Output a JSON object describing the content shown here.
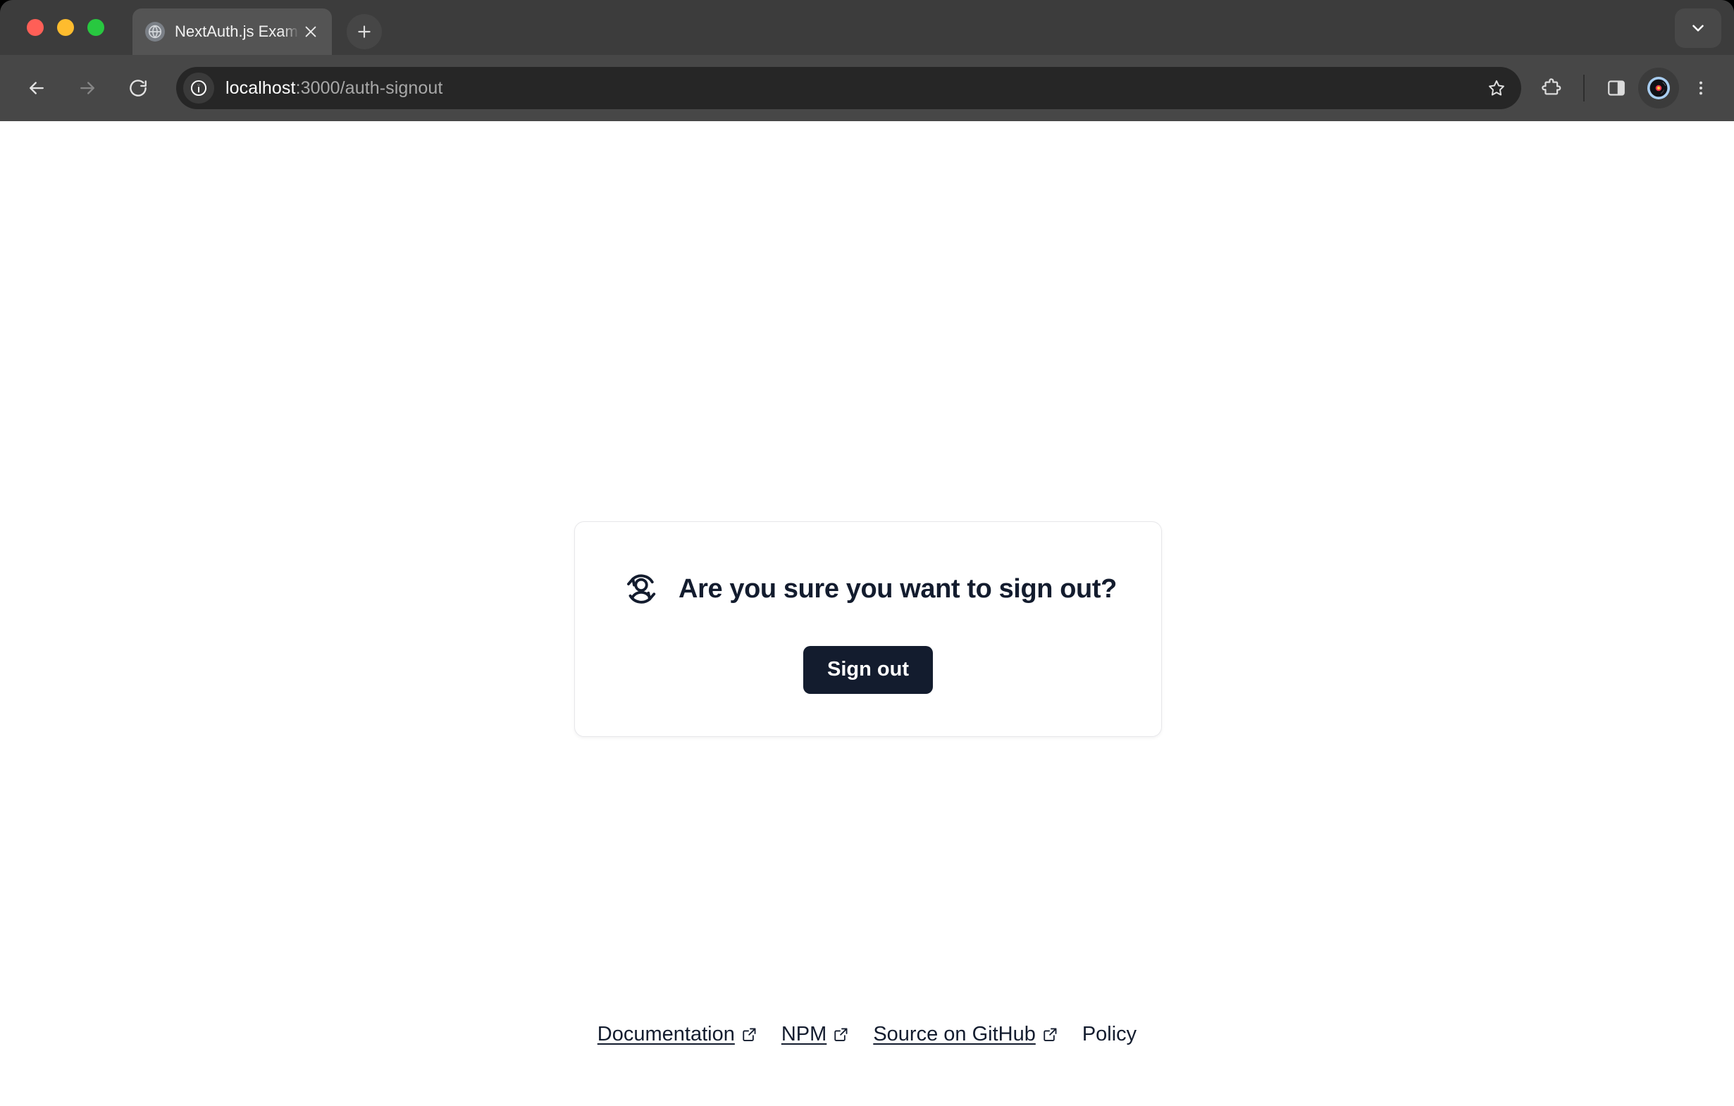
{
  "browser": {
    "traffic_lights": [
      {
        "name": "close",
        "color": "#ff5f57"
      },
      {
        "name": "minimize",
        "color": "#febc2e"
      },
      {
        "name": "maximize",
        "color": "#28c840"
      }
    ],
    "tab": {
      "title": "NextAuth.js Example",
      "favicon_icon": "globe-icon",
      "close_icon": "close-icon"
    },
    "new_tab_icon": "plus-icon",
    "tab_list_icon": "chevron-down-icon",
    "toolbar": {
      "back_icon": "arrow-left-icon",
      "forward_icon": "arrow-right-icon",
      "reload_icon": "reload-icon",
      "site_info_icon": "info-circle-icon",
      "url_host": "localhost",
      "url_path": ":3000/auth-signout",
      "url_full": "localhost:3000/auth-signout",
      "bookmark_icon": "star-icon",
      "extensions_icon": "puzzle-piece-icon",
      "side_panel_icon": "side-panel-icon",
      "profile_icon": "profile-avatar-icon",
      "menu_icon": "three-dots-vertical-icon"
    }
  },
  "page": {
    "card": {
      "icon": "user-signout-icon",
      "title": "Are you sure you want to sign out?",
      "signout_button_label": "Sign out"
    },
    "footer": {
      "links": [
        {
          "label": "Documentation",
          "external": true,
          "icon": "external-link-icon"
        },
        {
          "label": "NPM",
          "external": true,
          "icon": "external-link-icon"
        },
        {
          "label": "Source on GitHub",
          "external": true,
          "icon": "external-link-icon"
        },
        {
          "label": "Policy",
          "external": false,
          "icon": null
        }
      ]
    }
  },
  "colors": {
    "accent_dark": "#131c2e",
    "page_background": "#ffffff",
    "card_border": "#e7e7ea",
    "chrome_toolbar": "#474747",
    "chrome_tabstrip": "#3c3c3c",
    "omnibox": "#262626"
  }
}
